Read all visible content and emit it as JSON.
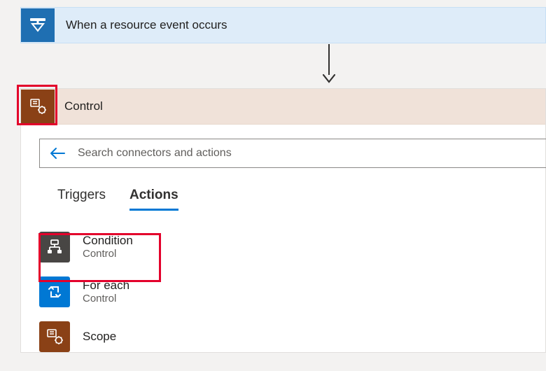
{
  "trigger": {
    "title": "When a resource event occurs"
  },
  "control": {
    "title": "Control",
    "search_placeholder": "Search connectors and actions"
  },
  "tabs": {
    "triggers": "Triggers",
    "actions": "Actions",
    "active": "actions"
  },
  "actions": [
    {
      "name": "Condition",
      "sub": "Control",
      "badge": "dark",
      "icon": "condition"
    },
    {
      "name": "For each",
      "sub": "Control",
      "badge": "blue",
      "icon": "foreach"
    },
    {
      "name": "Scope",
      "sub": "",
      "badge": "brown",
      "icon": "scope"
    }
  ]
}
